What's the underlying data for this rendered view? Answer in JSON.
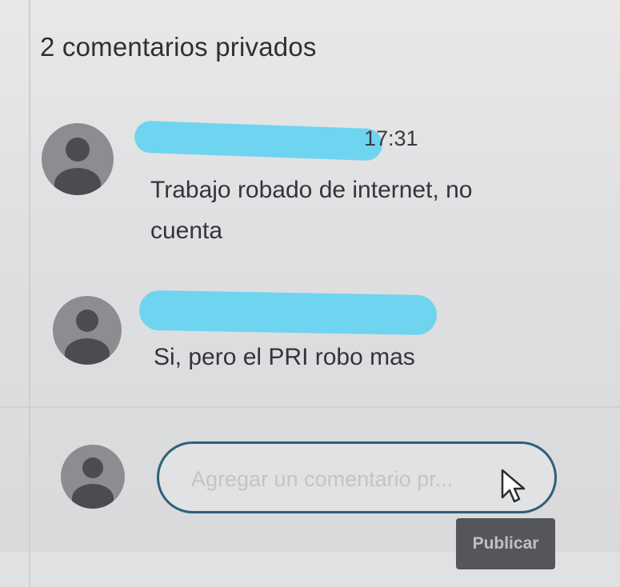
{
  "panel": {
    "title": "2 comentarios privados"
  },
  "comments": [
    {
      "author": "",
      "time": "17:31",
      "text_line1": "Trabajo robado de internet, no",
      "text_line2": "cuenta",
      "avatar_icon": "default-user-avatar-icon"
    },
    {
      "author": "",
      "time": "",
      "text_line1": "Si, pero el PRI robo mas",
      "avatar_icon": "default-user-avatar-icon"
    }
  ],
  "composer": {
    "placeholder": "Agregar un comentario pr...",
    "value": "",
    "publish_label": "Publicar",
    "cursor_icon": "mouse-pointer-icon"
  },
  "colors": {
    "redaction": "#6fd4ef",
    "input_border": "#2f5f7a",
    "publish_bg": "#55565b"
  }
}
